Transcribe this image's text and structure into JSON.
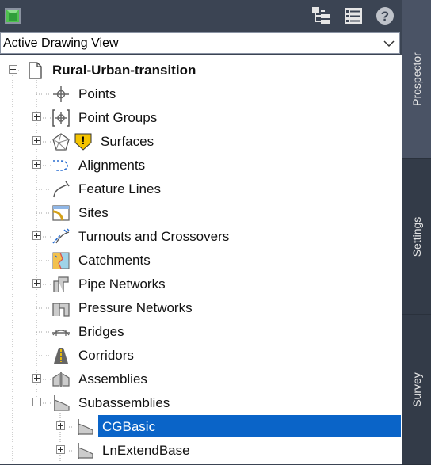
{
  "toolbar": {
    "app_icon": "green-cube-icon",
    "buttons": [
      "item-view-icon",
      "list-view-icon",
      "help-icon"
    ],
    "help_glyph": "?"
  },
  "view_selector": {
    "value": "Active Drawing View",
    "icon": "chevron-down-icon"
  },
  "tree": {
    "root": {
      "label": "Rural-Urban-transition",
      "icon": "drawing-icon",
      "expanded": true
    },
    "items": [
      {
        "label": "Points",
        "icon": "points-icon",
        "expander": "none"
      },
      {
        "label": "Point Groups",
        "icon": "point-groups-icon",
        "expander": "plus"
      },
      {
        "label": "Surfaces",
        "icon": "surfaces-icon",
        "warning_icon": "warning-icon",
        "warning_glyph": "!",
        "expander": "plus"
      },
      {
        "label": "Alignments",
        "icon": "alignments-icon",
        "expander": "plus"
      },
      {
        "label": "Feature Lines",
        "icon": "feature-lines-icon",
        "expander": "none"
      },
      {
        "label": "Sites",
        "icon": "sites-icon",
        "expander": "none"
      },
      {
        "label": "Turnouts and Crossovers",
        "icon": "turnouts-icon",
        "expander": "plus"
      },
      {
        "label": "Catchments",
        "icon": "catchments-icon",
        "expander": "none"
      },
      {
        "label": "Pipe Networks",
        "icon": "pipe-networks-icon",
        "expander": "plus"
      },
      {
        "label": "Pressure Networks",
        "icon": "pressure-networks-icon",
        "expander": "none"
      },
      {
        "label": "Bridges",
        "icon": "bridges-icon",
        "expander": "none"
      },
      {
        "label": "Corridors",
        "icon": "corridors-icon",
        "expander": "none"
      },
      {
        "label": "Assemblies",
        "icon": "assemblies-icon",
        "expander": "plus"
      },
      {
        "label": "Subassemblies",
        "icon": "subassemblies-icon",
        "expander": "minus",
        "children": [
          {
            "label": "CGBasic",
            "icon": "subassembly-icon",
            "expander": "plus",
            "selected": true
          },
          {
            "label": "LnExtendBase",
            "icon": "subassembly-icon",
            "expander": "plus"
          }
        ]
      }
    ]
  },
  "side_tabs": [
    {
      "label": "Prospector",
      "active": true
    },
    {
      "label": "Settings",
      "active": false
    },
    {
      "label": "Survey",
      "active": false
    }
  ],
  "colors": {
    "panel_bg": "#3b4453",
    "tree_bg": "#ffffff",
    "selection": "#0a64c8",
    "warning": "#f5c400"
  }
}
